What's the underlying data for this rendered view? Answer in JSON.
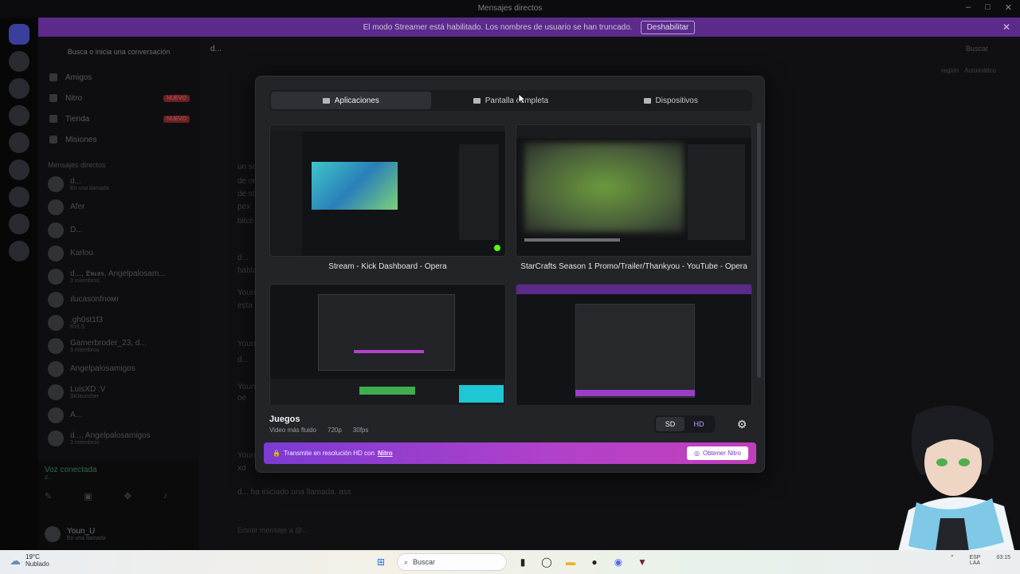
{
  "window": {
    "title": "Mensajes directos"
  },
  "streamer_bar": {
    "message": "El modo Streamer está habilitado. Los nombres de usuario se han truncado.",
    "disable_label": "Deshabilitar"
  },
  "sidebar": {
    "search_placeholder": "Busca o inicia una conversación",
    "nav": [
      {
        "label": "Amigos",
        "badge": ""
      },
      {
        "label": "Nitro",
        "badge": "NUEVO"
      },
      {
        "label": "Tienda",
        "badge": "NUEVO"
      },
      {
        "label": "Misiones",
        "badge": ""
      }
    ],
    "dm_header": "Mensajes directos",
    "dms": [
      {
        "name": "d...",
        "sub": "En una llamada"
      },
      {
        "name": "Afer",
        "sub": ""
      },
      {
        "name": "D...",
        "sub": ""
      },
      {
        "name": "Karlou",
        "sub": ""
      },
      {
        "name": "d..., 𝕷𝖚𝖈𝖆𝖘, Angelpalosam...",
        "sub": "3 miembros"
      },
      {
        "name": "ılucasonfnoмı",
        "sub": ""
      },
      {
        "name": ".gh0st1f3",
        "sub": "RVLS"
      },
      {
        "name": "Gamerbroder_23, d...",
        "sub": "3 miembros"
      },
      {
        "name": "Angelpalosamigos",
        "sub": ""
      },
      {
        "name": "LuisXD :V",
        "sub": "SKlauncher"
      },
      {
        "name": "A...",
        "sub": ""
      },
      {
        "name": "d..., Angelpalosamigos",
        "sub": "3 miembros"
      }
    ],
    "voice": {
      "status": "Voz conectada",
      "channel": "d..."
    },
    "user": {
      "name": "Youn_U",
      "status": "En una llamada"
    }
  },
  "main": {
    "header": "d...",
    "search_placeholder": "Buscar",
    "region_label": "región",
    "region_value": "Automático",
    "chat_lines": [
      "un so",
      "de or",
      "de st",
      "pex",
      "bitch",
      "d...",
      "habla",
      "Youn",
      "esta",
      "Youn",
      "d...",
      "Youn",
      "oe",
      "Youn",
      "xd"
    ],
    "call_started": "d... ha iniciado una llamada. ass",
    "input_placeholder": "Enviar mensaje a @..."
  },
  "modal": {
    "tabs": [
      {
        "label": "Aplicaciones",
        "icon": "window-icon",
        "active": true
      },
      {
        "label": "Pantalla completa",
        "icon": "monitor-icon",
        "active": false
      },
      {
        "label": "Dispositivos",
        "icon": "camera-icon",
        "active": false
      }
    ],
    "sources": [
      {
        "title": "Stream - Kick Dashboard - Opera"
      },
      {
        "title": "StarCrafts Season 1 Promo/Trailer/Thankyou - YouTube - Opera"
      },
      {
        "title": ""
      },
      {
        "title": ""
      }
    ],
    "section": {
      "title": "Juegos",
      "subtitle": "Video más fluido",
      "resolution": "720p",
      "fps": "30fps"
    },
    "quality": {
      "sd": "SD",
      "hd": "HD",
      "selected": "SD"
    },
    "promo": {
      "text": "Transmite en resolución HD con",
      "nitro_word": "Nitro",
      "button": "Obtener Nitro"
    }
  },
  "taskbar": {
    "weather_temp": "19°C",
    "weather_desc": "Nublado",
    "search_placeholder": "Buscar",
    "lang_top": "ESP",
    "lang_bottom": "LAA",
    "time": "03:15"
  },
  "colors": {
    "accent": "#5865f2",
    "nitro_gradient_start": "#7c3bd3",
    "nitro_gradient_end": "#c23fba",
    "streamer_bar": "#5b2a8a"
  }
}
